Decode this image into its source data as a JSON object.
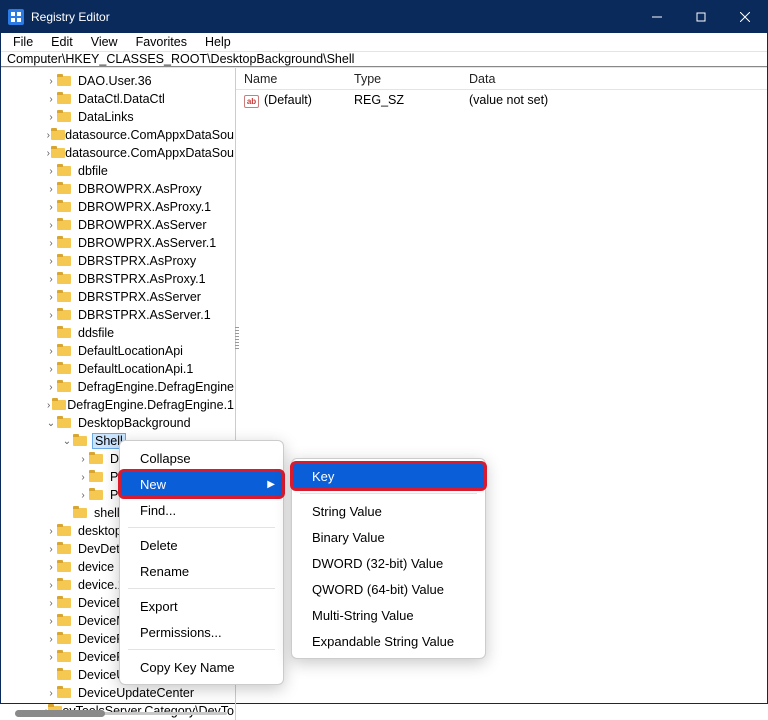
{
  "title": "Registry Editor",
  "menubar": [
    "File",
    "Edit",
    "View",
    "Favorites",
    "Help"
  ],
  "address": "Computer\\HKEY_CLASSES_ROOT\\DesktopBackground\\Shell",
  "tree": [
    {
      "d": 2,
      "e": ">",
      "l": "DAO.User.36"
    },
    {
      "d": 2,
      "e": ">",
      "l": "DataCtl.DataCtl"
    },
    {
      "d": 2,
      "e": ">",
      "l": "DataLinks"
    },
    {
      "d": 2,
      "e": ">",
      "l": "datasource.ComAppxDataSou"
    },
    {
      "d": 2,
      "e": ">",
      "l": "datasource.ComAppxDataSou"
    },
    {
      "d": 2,
      "e": ">",
      "l": "dbfile"
    },
    {
      "d": 2,
      "e": ">",
      "l": "DBROWPRX.AsProxy"
    },
    {
      "d": 2,
      "e": ">",
      "l": "DBROWPRX.AsProxy.1"
    },
    {
      "d": 2,
      "e": ">",
      "l": "DBROWPRX.AsServer"
    },
    {
      "d": 2,
      "e": ">",
      "l": "DBROWPRX.AsServer.1"
    },
    {
      "d": 2,
      "e": ">",
      "l": "DBRSTPRX.AsProxy"
    },
    {
      "d": 2,
      "e": ">",
      "l": "DBRSTPRX.AsProxy.1"
    },
    {
      "d": 2,
      "e": ">",
      "l": "DBRSTPRX.AsServer"
    },
    {
      "d": 2,
      "e": ">",
      "l": "DBRSTPRX.AsServer.1"
    },
    {
      "d": 2,
      "e": "",
      "l": "ddsfile"
    },
    {
      "d": 2,
      "e": ">",
      "l": "DefaultLocationApi"
    },
    {
      "d": 2,
      "e": ">",
      "l": "DefaultLocationApi.1"
    },
    {
      "d": 2,
      "e": ">",
      "l": "DefragEngine.DefragEngine"
    },
    {
      "d": 2,
      "e": ">",
      "l": "DefragEngine.DefragEngine.1"
    },
    {
      "d": 2,
      "e": "v",
      "l": "DesktopBackground"
    },
    {
      "d": 3,
      "e": "v",
      "l": "Shell",
      "sel": true
    },
    {
      "d": 4,
      "e": ">",
      "l": "Di"
    },
    {
      "d": 4,
      "e": ">",
      "l": "Pe"
    },
    {
      "d": 4,
      "e": ">",
      "l": "Pe"
    },
    {
      "d": 3,
      "e": "",
      "l": "shelle"
    },
    {
      "d": 2,
      "e": ">",
      "l": "desktop"
    },
    {
      "d": 2,
      "e": ">",
      "l": "DevDeta"
    },
    {
      "d": 2,
      "e": ">",
      "l": "device"
    },
    {
      "d": 2,
      "e": ">",
      "l": "device.1"
    },
    {
      "d": 2,
      "e": ">",
      "l": "DeviceD"
    },
    {
      "d": 2,
      "e": ">",
      "l": "DeviceM"
    },
    {
      "d": 2,
      "e": ">",
      "l": "DeviceR"
    },
    {
      "d": 2,
      "e": ">",
      "l": "DeviceRect.DeviceRect.1"
    },
    {
      "d": 2,
      "e": "",
      "l": "DeviceUpdate"
    },
    {
      "d": 2,
      "e": ">",
      "l": "DeviceUpdateCenter"
    },
    {
      "d": 2,
      "e": ">",
      "l": "DevToolsServer.Category\\DevTo"
    }
  ],
  "list": {
    "cols": [
      "Name",
      "Type",
      "Data"
    ],
    "rows": [
      {
        "name": "(Default)",
        "type": "REG_SZ",
        "data": "(value not set)"
      }
    ]
  },
  "ctx1": {
    "items": [
      "Collapse",
      "New",
      "Find...",
      "__sep",
      "Delete",
      "Rename",
      "__sep",
      "Export",
      "Permissions...",
      "__sep",
      "Copy Key Name"
    ],
    "highlight": "New"
  },
  "ctx2": {
    "items": [
      "Key",
      "__sep",
      "String Value",
      "Binary Value",
      "DWORD (32-bit) Value",
      "QWORD (64-bit) Value",
      "Multi-String Value",
      "Expandable String Value"
    ],
    "highlight": "Key"
  }
}
